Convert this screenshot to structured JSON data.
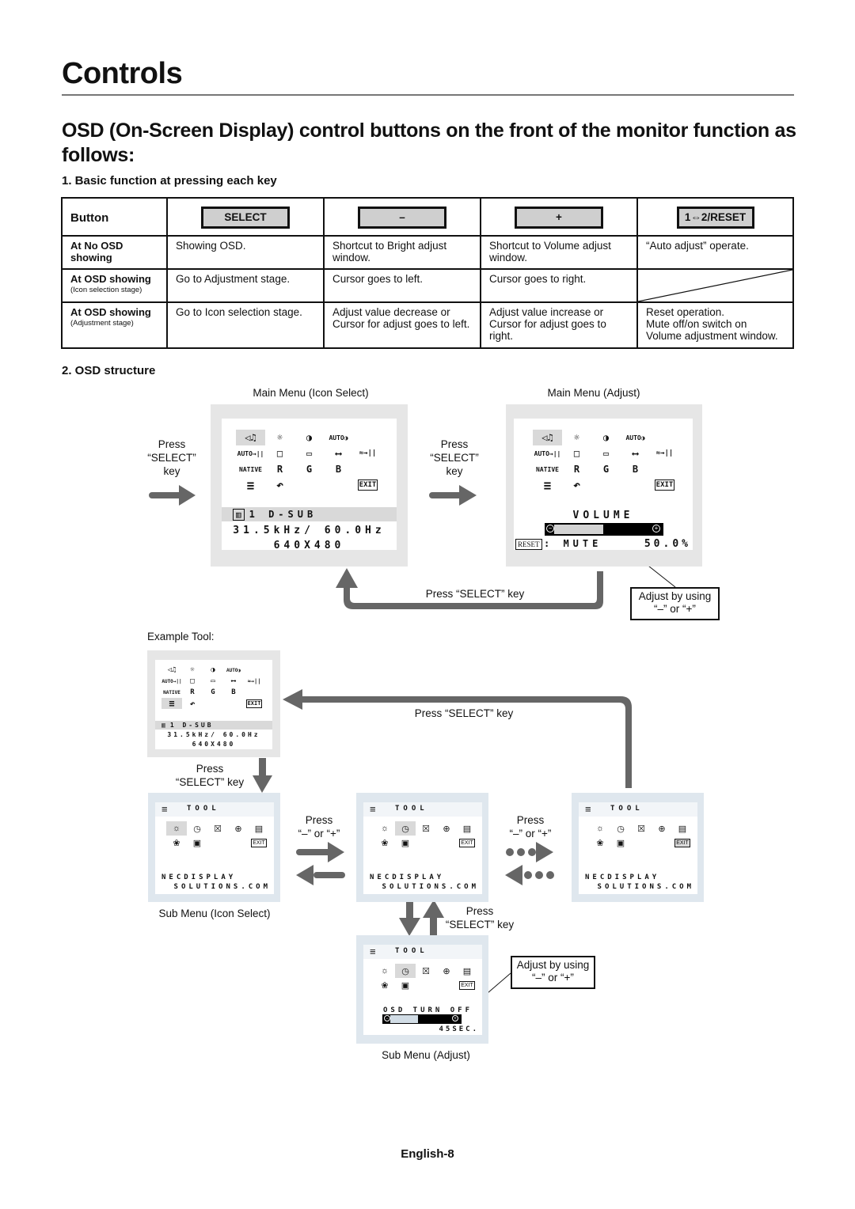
{
  "page": {
    "title": "Controls",
    "subtitle": "OSD (On-Screen Display) control buttons on the front of the monitor function as follows:",
    "section1": "1. Basic function at pressing each key",
    "section2": "2. OSD structure",
    "footer": "English-8"
  },
  "key_table": {
    "header_label": "Button",
    "buttons": [
      "SELECT",
      "–",
      "+",
      "1⇔2/RESET"
    ],
    "rows": [
      {
        "title": "At No OSD showing",
        "note": "",
        "cells": [
          "Showing OSD.",
          "Shortcut to Bright adjust window.",
          "Shortcut to Volume adjust window.",
          "“Auto adjust” operate."
        ]
      },
      {
        "title": "At OSD showing",
        "note": "(Icon selection stage)",
        "cells": [
          "Go to Adjustment stage.",
          "Cursor goes to left.",
          "Cursor goes to right.",
          ""
        ]
      },
      {
        "title": "At OSD showing",
        "note": "(Adjustment stage)",
        "cells": [
          "Go to Icon selection stage.",
          "Adjust value decrease or Cursor for adjust goes to left.",
          "Adjust value increase or Cursor for adjust goes to right.",
          "Reset operation.\nMute off/on switch on Volume adjustment window."
        ]
      }
    ]
  },
  "diagram": {
    "main_icon_select_caption": "Main Menu (Icon Select)",
    "main_adjust_caption": "Main Menu (Adjust)",
    "press_select_left": [
      "Press",
      "“SELECT”",
      "key"
    ],
    "press_select_mid": [
      "Press",
      "“SELECT”",
      "key"
    ],
    "press_select_return": "Press “SELECT” key",
    "adjust_note_1": [
      "Adjust by using",
      "“–” or “+”"
    ],
    "example_tool_label": "Example Tool:",
    "press_select_tool_return": "Press “SELECT” key",
    "press_select_down": [
      "Press",
      "“SELECT” key"
    ],
    "press_minus_plus_1": [
      "Press",
      "“–” or “+”"
    ],
    "press_minus_plus_2": [
      "Press",
      "“–” or “+”"
    ],
    "press_select_sub": [
      "Press",
      "“SELECT” key"
    ],
    "sub_icon_select_caption": "Sub Menu (Icon Select)",
    "sub_adjust_caption": "Sub Menu (Adjust)",
    "adjust_note_2": [
      "Adjust by using",
      "“–” or “+”"
    ]
  },
  "osd_main": {
    "icons": [
      "◁♫",
      "☼",
      "◑",
      "AUTO◑",
      "",
      "AUTO→||",
      "□",
      "▭",
      "⟷",
      "≈→||",
      "NATIVE",
      "R",
      "G",
      "B",
      "",
      "≡",
      "↶",
      "",
      "",
      "EXIT"
    ],
    "input_label": "1  D-SUB",
    "frequency": "31.5kHz/ 60.0Hz",
    "resolution": "640X480"
  },
  "osd_adjust": {
    "item": "VOLUME",
    "value_percent": 50.0,
    "value_label": "50.0%",
    "reset_label": "RESET",
    "reset_action": ": MUTE"
  },
  "osd_tool": {
    "title": "TOOL",
    "icons_row1": [
      "☼",
      "◷",
      "☒",
      "⊕",
      "▤"
    ],
    "icons_row2": [
      "❀",
      "▣",
      "",
      "",
      "EXIT"
    ],
    "brand_line1": "NECDISPLAY",
    "brand_line2": "SOLUTIONS.COM",
    "adjust_item": "OSD TURN OFF",
    "adjust_value_fraction": 0.45,
    "adjust_value_label": "45SEC."
  }
}
